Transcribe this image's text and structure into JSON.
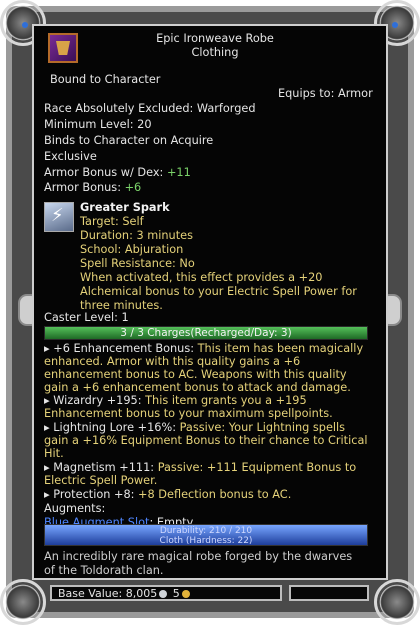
{
  "item": {
    "name": "Epic Ironweave Robe",
    "type": "Clothing",
    "bound": "Bound to Character",
    "equips_to": "Equips to:  Armor",
    "race_excluded": "Race Absolutely Excluded: Warforged",
    "min_level": "Minimum Level: 20",
    "binds": "Binds to Character on Acquire",
    "exclusive": "Exclusive",
    "armor_bonus_dex_label": "Armor Bonus w/ Dex:",
    "armor_bonus_dex_value": "+11",
    "armor_bonus_label": "Armor Bonus:",
    "armor_bonus_value": "+6"
  },
  "spell": {
    "name": "Greater Spark",
    "target": "Target: Self",
    "duration": "Duration: 3 minutes",
    "school": "School: Abjuration",
    "resistance": "Spell Resistance: No",
    "desc_1": "When activated, this effect provides a +20",
    "desc_2": "Alchemical bonus to your Electric Spell Power for",
    "desc_3": "three minutes."
  },
  "caster_level": "Caster Level:  1",
  "charges": "3 / 3 Charges(Recharged/Day: 3)",
  "effects": [
    {
      "lines": [
        "+6 Enhancement Bonus:",
        " This item has been magically",
        "enhanced. Armor with this quality gains a +6",
        "enhancement bonus to AC. Weapons with this quality",
        "gain a +6 enhancement bonus to attack and damage."
      ]
    },
    {
      "lines": [
        "Wizardry +195:",
        " This item grants you a +195",
        "Enhancement bonus to your maximum spellpoints."
      ]
    },
    {
      "lines": [
        "Lightning Lore +16%:",
        " Passive: Your Lightning spells",
        "gain a +16% Equipment Bonus to their chance to Critical",
        "Hit."
      ]
    },
    {
      "lines": [
        "Magnetism +111:",
        " Passive: +111 Equipment Bonus to",
        "Electric Spell Power."
      ]
    },
    {
      "lines": [
        "Protection +8:",
        " +8 Deflection bonus to AC."
      ]
    }
  ],
  "augments_label": "Augments:",
  "augment_slot_name": "Blue Augment Slot",
  "augment_slot_value": ": Empty",
  "durability": "Durability: 210 / 210",
  "material": "Cloth (Hardness: 22)",
  "flavor_1": "An incredibly rare magical robe forged by the dwarves",
  "flavor_2": "of the Toldorath clan.",
  "base_value_label": "Base Value:",
  "base_value_platinum": "8,005",
  "base_value_gold": "5",
  "icons": {
    "item": "robe-icon",
    "spell": "lightning-spell-icon",
    "platinum": "platinum-coin-icon",
    "gold": "gold-coin-icon"
  },
  "colors": {
    "green_value": "#7bd36a",
    "yellow_text": "#e5d27a",
    "blue_link": "#4f86ff",
    "charges_bar": "#3a9a40",
    "durability_bar": "#3f6fe0"
  }
}
